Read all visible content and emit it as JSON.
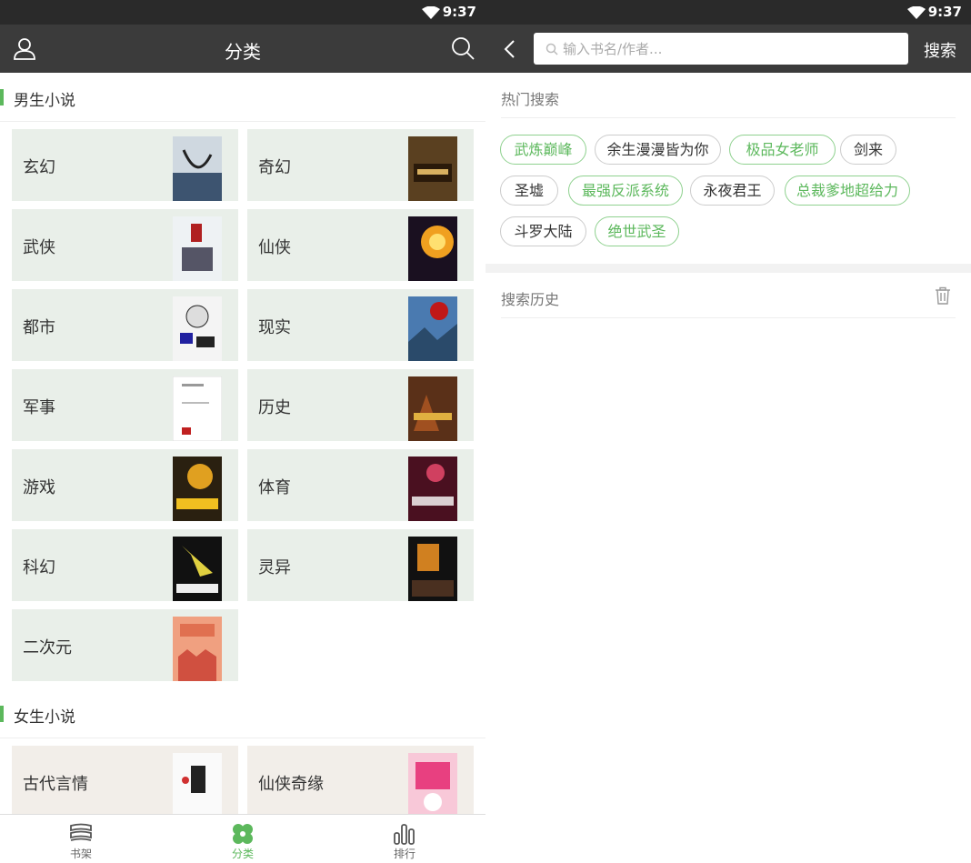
{
  "status": {
    "time": "9:37"
  },
  "category_screen": {
    "title": "分类",
    "sections": [
      {
        "label": "男生小说",
        "categories": [
          "玄幻",
          "奇幻",
          "武侠",
          "仙侠",
          "都市",
          "现实",
          "军事",
          "历史",
          "游戏",
          "体育",
          "科幻",
          "灵异",
          "二次元"
        ]
      },
      {
        "label": "女生小说",
        "categories": [
          "古代言情",
          "仙侠奇缘"
        ]
      }
    ],
    "nav": [
      {
        "label": "书架",
        "icon": "bookshelf-icon"
      },
      {
        "label": "分类",
        "icon": "category-clover-icon",
        "active": true
      },
      {
        "label": "排行",
        "icon": "ranking-bars-icon"
      }
    ]
  },
  "search_screen": {
    "placeholder": "输入书名/作者...",
    "search_label": "搜索",
    "hot_label": "热门搜索",
    "hot_tags": [
      {
        "text": "武炼巅峰",
        "highlight": true
      },
      {
        "text": "余生漫漫皆为你",
        "highlight": false
      },
      {
        "text": "极品女老师",
        "highlight": true
      },
      {
        "text": "剑来",
        "highlight": false
      },
      {
        "text": "圣墟",
        "highlight": false
      },
      {
        "text": "最强反派系统",
        "highlight": true
      },
      {
        "text": "永夜君王",
        "highlight": false
      },
      {
        "text": "总裁爹地超给力",
        "highlight": true
      },
      {
        "text": "斗罗大陆",
        "highlight": false
      },
      {
        "text": "绝世武圣",
        "highlight": true
      }
    ],
    "history_label": "搜索历史"
  },
  "colors": {
    "accent": "#5cb85c",
    "topbar": "#3b3b3b",
    "statusbar": "#2a2a2a"
  }
}
